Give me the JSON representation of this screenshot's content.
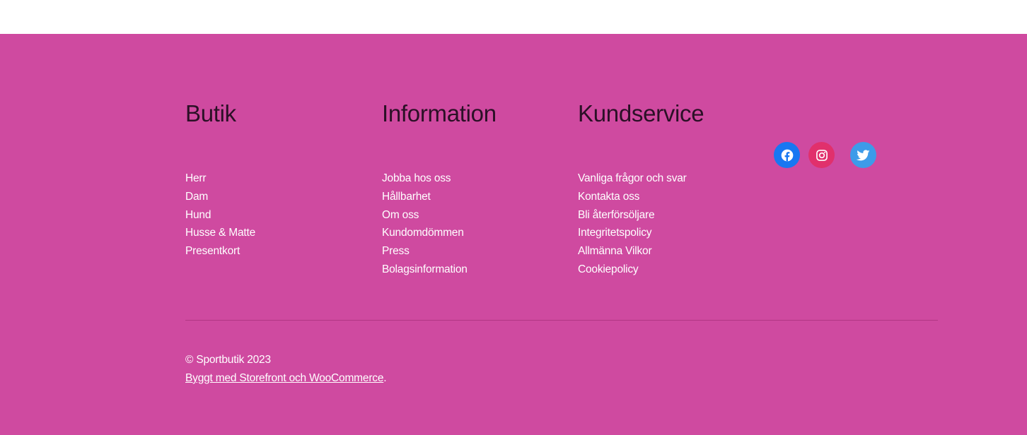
{
  "footer": {
    "columns": [
      {
        "title": "Butik",
        "links": [
          "Herr",
          "Dam",
          "Hund",
          "Husse & Matte",
          "Presentkort"
        ]
      },
      {
        "title": "Information",
        "links": [
          "Jobba hos oss",
          "Hållbarhet",
          "Om oss",
          "Kundomdömmen",
          "Press",
          "Bolagsinformation"
        ]
      },
      {
        "title": "Kundservice",
        "links": [
          "Vanliga frågor och svar",
          "Kontakta oss",
          "Bli återförsöljare",
          "Integritetspolicy",
          "Allmänna Vilkor",
          "Cookiepolicy"
        ]
      }
    ],
    "social": [
      {
        "icon": "facebook-icon",
        "color": "#1877f2"
      },
      {
        "icon": "instagram-icon",
        "color": "#e1306c"
      },
      {
        "icon": "twitter-icon",
        "color": "#1da1f2"
      }
    ],
    "copyright": "© Sportbutik 2023",
    "credit_link": "Byggt med Storefront och WooCommerce",
    "credit_suffix": "."
  },
  "colors": {
    "footer_background": "#cf4aa0",
    "heading_text": "#2b1026",
    "link_text": "#ffffff"
  }
}
